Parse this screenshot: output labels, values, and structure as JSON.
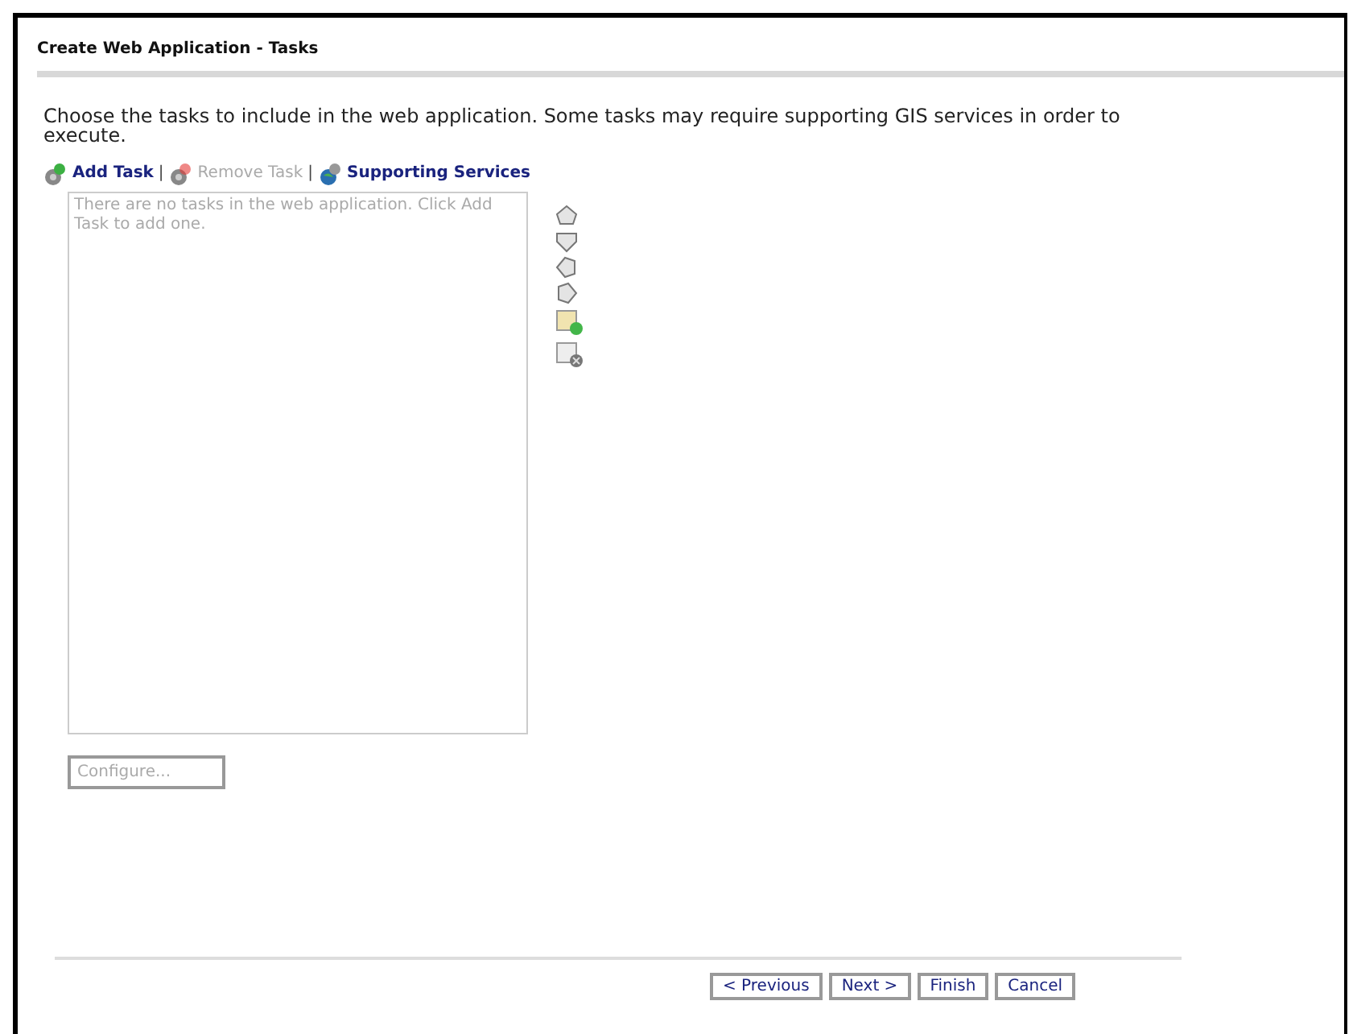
{
  "title": "Create Web Application - Tasks",
  "instructions": "Choose the tasks to include in the web application. Some tasks may require supporting GIS services in order to execute.",
  "toolbar_separator": "|",
  "toolbar": [
    {
      "kind": "add",
      "label": "Add Task",
      "disabled": false
    },
    {
      "kind": "remove",
      "label": "Remove Task",
      "disabled": true
    },
    {
      "kind": "services",
      "label": "Supporting Services",
      "disabled": false
    }
  ],
  "task_list": {
    "placeholder": "There are no tasks in the web application. Click Add Task to add one."
  },
  "configure_button": {
    "label": "Configure...",
    "disabled": true
  },
  "buttons": [
    {
      "label": "< Previous"
    },
    {
      "label": "Next >"
    },
    {
      "label": "Finish"
    },
    {
      "label": "Cancel"
    }
  ]
}
